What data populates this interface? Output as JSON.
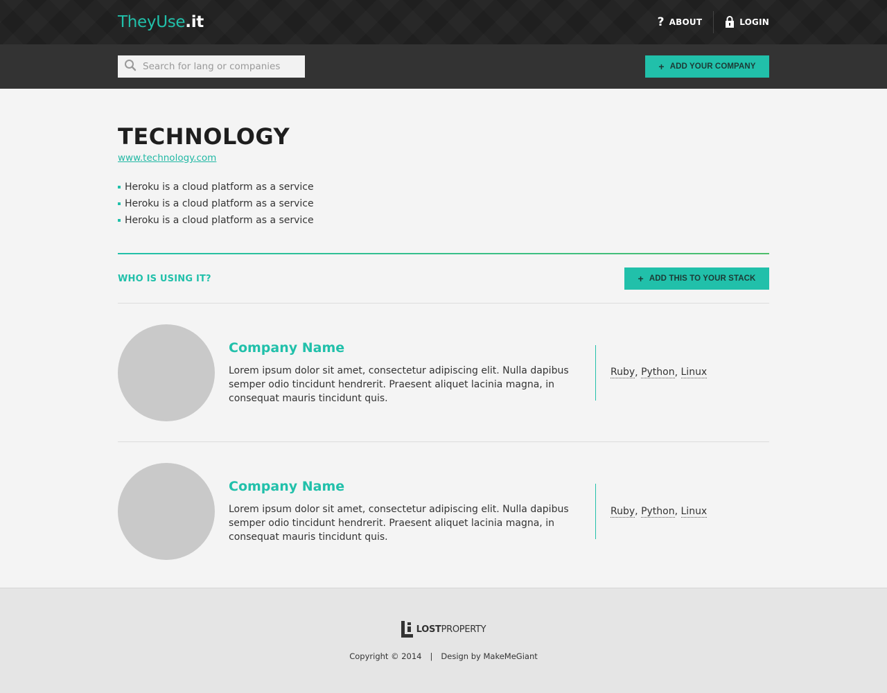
{
  "header": {
    "logo_brand": "TheyUse",
    "logo_tld": ".it",
    "about_label": "ABOUT",
    "login_label": "LOGIN"
  },
  "subbar": {
    "search_placeholder": "Search for lang or companies",
    "add_company_label": "ADD YOUR COMPANY"
  },
  "technology": {
    "title": "TECHNOLOGY",
    "url": "www.technology.com",
    "bullets": [
      "Heroku is a cloud platform as a service",
      "Heroku is a cloud platform as a service",
      "Heroku is a cloud platform as a service"
    ]
  },
  "using": {
    "title": "WHO IS USING IT?",
    "add_stack_label": "ADD THIS TO YOUR STACK"
  },
  "companies": [
    {
      "name": "Company Name",
      "description": "Lorem ipsum dolor sit amet, consectetur adipiscing elit. Nulla dapibus semper odio tincidunt hendrerit. Praesent aliquet lacinia magna, in consequat mauris tincidunt quis.",
      "tags": [
        "Ruby",
        "Python",
        "Linux"
      ]
    },
    {
      "name": "Company Name",
      "description": "Lorem ipsum dolor sit amet, consectetur adipiscing elit. Nulla dapibus semper odio tincidunt hendrerit. Praesent aliquet lacinia magna, in consequat mauris tincidunt quis.",
      "tags": [
        "Ruby",
        "Python",
        "Linux"
      ]
    }
  ],
  "footer": {
    "logo_bold": "LOST",
    "logo_regular": "PROPERTY",
    "copyright": "Copyright © 2014",
    "separator": "|",
    "credit": "Design by MakeMeGiant"
  },
  "colors": {
    "accent": "#21c0aa",
    "header_bg": "#1f1f1f",
    "subbar_bg": "#333333",
    "page_bg": "#f4f4f4",
    "footer_bg": "#e5e5e5"
  },
  "icons": {
    "about": "question-mark-icon",
    "login": "lock-icon",
    "search": "search-icon",
    "add": "plus-icon",
    "footer_logo": "lost-property-logo"
  }
}
